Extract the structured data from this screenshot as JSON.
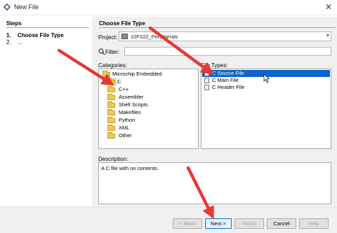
{
  "window": {
    "title": "New File",
    "close_glyph": "✕"
  },
  "steps": {
    "heading": "Steps",
    "items": [
      {
        "num": "1.",
        "label": "Choose File Type"
      },
      {
        "num": "2.",
        "label": "..."
      }
    ]
  },
  "main": {
    "heading": "Choose File Type",
    "project": {
      "label": "Project:",
      "value": "10F322_Peripherals"
    },
    "filter": {
      "label": "Filter:",
      "value": ""
    },
    "categories": {
      "label": "Categories:",
      "items": [
        {
          "label": "Microchip Embedded"
        },
        {
          "label": "C"
        },
        {
          "label": "C++"
        },
        {
          "label": "Assembler"
        },
        {
          "label": "Shell Scripts"
        },
        {
          "label": "Makefiles"
        },
        {
          "label": "Python"
        },
        {
          "label": "XML"
        },
        {
          "label": "Other"
        }
      ],
      "selected_index": 1
    },
    "file_types": {
      "label": "File Types:",
      "items": [
        {
          "label": "C Source File"
        },
        {
          "label": "C Main File"
        },
        {
          "label": "C Header File"
        }
      ],
      "selected_index": 0
    },
    "description": {
      "label": "Description:",
      "text": "A C file with no contents."
    }
  },
  "buttons": {
    "back": "< Back",
    "next": "Next >",
    "finish": "Finish",
    "cancel": "Cancel",
    "help": "Help"
  },
  "colors": {
    "annotation_arrow": "#e53935",
    "selection": "#0a64cc",
    "folder": "#f0c95a"
  }
}
